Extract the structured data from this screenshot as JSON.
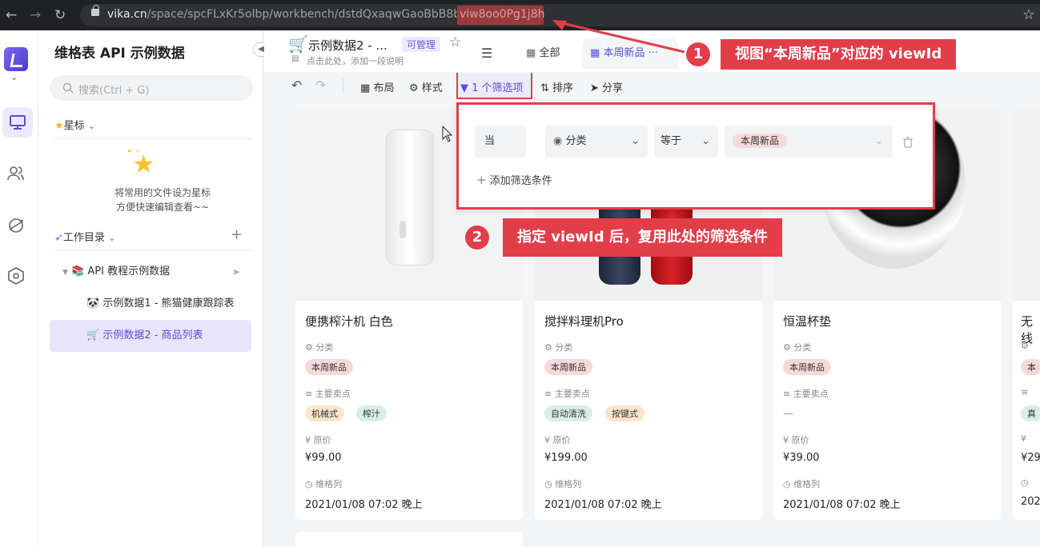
{
  "browser": {
    "url_host": "vika.cn",
    "url_path": "/space/spcFLxKr5olbp/workbench/dstdQxaqwGaoBbB8bK/",
    "url_view_id": "viw8oo0Pg1j8h"
  },
  "sidebar": {
    "space_title": "维格表 API 示例数据",
    "search_placeholder": "搜索(Ctrl + G)",
    "star_section": "星标",
    "empty_star_text_1": "将常用的文件设为星标",
    "empty_star_text_2": "方便快速编辑查看~~",
    "workdir_section": "工作目录",
    "tree": [
      {
        "icon": "📚",
        "label": "API 教程示例数据"
      },
      {
        "icon": "🐼",
        "label": "示例数据1 - 熊猫健康跟踪表"
      },
      {
        "icon": "🛒",
        "label": "示例数据2 - 商品列表"
      }
    ]
  },
  "header": {
    "sheet_title": "示例数据2 - ...",
    "badge": "可管理",
    "desc": "点击此处，添加一段说明",
    "tabs": [
      "全部",
      "本周新品"
    ]
  },
  "toolbar": {
    "layout": "布局",
    "style": "样式",
    "filter": "1 个筛选项",
    "sort": "排序",
    "share": "分享"
  },
  "filter": {
    "conjunction": "当",
    "field": "分类",
    "operator": "等于",
    "value": "本周新品",
    "add_label": "添加筛选条件"
  },
  "cards": [
    {
      "name": "便携榨汁机 白色",
      "category": "本周新品",
      "points": [
        "机械式",
        "榨汁"
      ],
      "price": "¥99.00",
      "time": "2021/01/08  07:02  晚上"
    },
    {
      "name": "搅拌料理机Pro",
      "category": "本周新品",
      "points": [
        "自动清洗",
        "按键式"
      ],
      "price": "¥199.00",
      "time": "2021/01/08  07:02  晚上"
    },
    {
      "name": "恒温杯垫",
      "category": "本周新品",
      "points_empty": "—",
      "price": "¥39.00",
      "time": "2021/01/08  07:02  晚上"
    },
    {
      "name": "无线",
      "category": "本",
      "point_partial": "真",
      "price": "¥29",
      "time": "202"
    }
  ],
  "field_labels": {
    "category": "分类",
    "points": "主要卖点",
    "price": "原价",
    "time": "维格列"
  },
  "callouts": {
    "one_num": "1",
    "one_text": "视图“本周新品”对应的 viewId",
    "two_num": "2",
    "two_text": "指定 viewId 后，复用此处的筛选条件"
  },
  "colors": {
    "accent": "#e23e4a",
    "brand": "#5b4cd8",
    "tag_red": "#f6dad9",
    "tag_orange": "#fde5cc",
    "tag_green": "#d7f0e6"
  }
}
